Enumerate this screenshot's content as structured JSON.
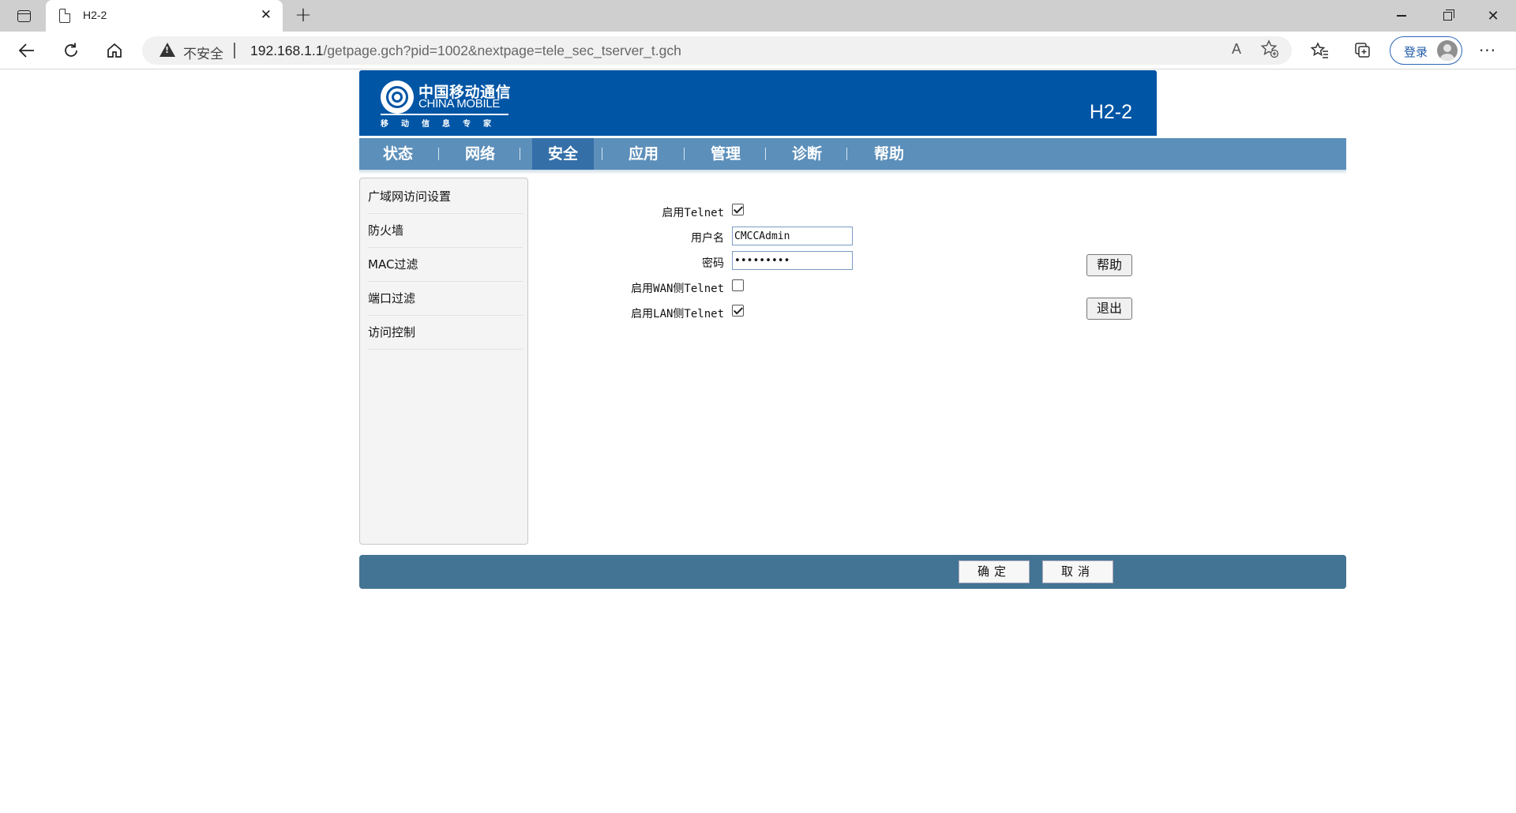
{
  "browser": {
    "tab_title": "H2-2",
    "tab_close": "✕",
    "new_tab": "+",
    "security_label": "不安全",
    "url_host": "192.168.1.1",
    "url_path": "/getpage.gch?pid=1002&nextpage=tele_sec_tserver_t.gch",
    "read_aloud_icon": "A",
    "login_label": "登录",
    "icons": [
      "sidebar-toggle-icon",
      "page-icon",
      "back-arrow-icon",
      "reload-icon",
      "home-icon",
      "warning-icon",
      "read-aloud-icon",
      "add-favorite-icon",
      "favorites-icon",
      "collections-icon",
      "profile-avatar-icon",
      "more-options-icon",
      "minimize-icon",
      "maximize-icon",
      "close-icon"
    ]
  },
  "header": {
    "logo_cn": "中国移动通信",
    "logo_en": "CHINA MOBILE",
    "logo_slogan": "移动信息专家",
    "model": "H2-2",
    "brand_color": "#0055a5"
  },
  "menu": {
    "items": [
      "状态",
      "网络",
      "安全",
      "应用",
      "管理",
      "诊断",
      "帮助"
    ],
    "active_index": 2
  },
  "sidebar": {
    "items": [
      "广域网访问设置",
      "防火墙",
      "MAC过滤",
      "端口过滤",
      "访问控制"
    ]
  },
  "form": {
    "enable_telnet_label": "启用Telnet",
    "enable_telnet": true,
    "username_label": "用户名",
    "username_value": "CMCCAdmin",
    "password_label": "密码",
    "password_mask": "•••••••••",
    "enable_wan_telnet_label": "启用WAN侧Telnet",
    "enable_wan_telnet": false,
    "enable_lan_telnet_label": "启用LAN侧Telnet",
    "enable_lan_telnet": true
  },
  "buttons": {
    "help": "帮助",
    "logout": "退出",
    "confirm": "确定",
    "cancel": "取消"
  }
}
